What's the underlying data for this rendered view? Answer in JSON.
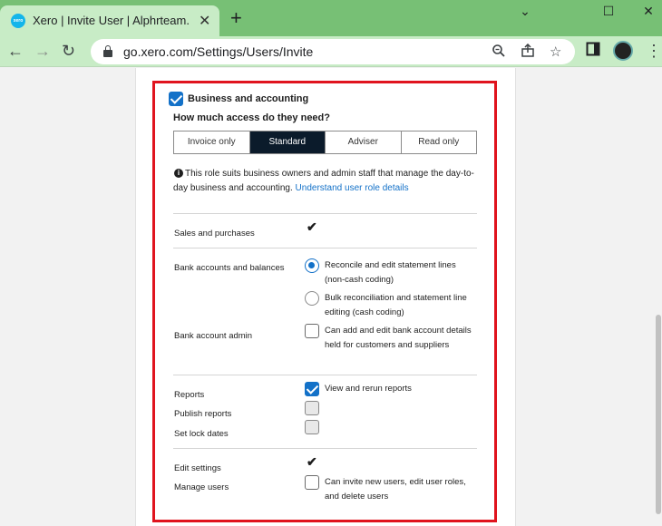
{
  "browser": {
    "tab_title": "Xero | Invite User | Alphrteam.com",
    "favicon_text": "xero",
    "new_tab_label": "+",
    "url": "go.xero.com/Settings/Users/Invite"
  },
  "permissions": {
    "section_label": "Business and accounting",
    "section_checked": true,
    "access_question": "How much access do they need?",
    "access_levels": [
      "Invoice only",
      "Standard",
      "Adviser",
      "Read only"
    ],
    "selected_level": "Standard",
    "info_text": "This role suits business owners and admin staff that manage the day-to-day business and accounting.",
    "info_link": "Understand user role details",
    "sales_label": "Sales and purchases",
    "bank_label": "Bank accounts and balances",
    "bank_option_1": "Reconcile and edit statement lines (non-cash coding)",
    "bank_option_2": "Bulk reconciliation and statement line editing (cash coding)",
    "bank_admin_label": "Bank account admin",
    "bank_admin_option": "Can add and edit bank account details held for customers and suppliers",
    "reports_label": "Reports",
    "reports_option": "View and rerun reports",
    "publish_reports_label": "Publish reports",
    "lock_dates_label": "Set lock dates",
    "edit_settings_label": "Edit settings",
    "manage_users_label": "Manage users",
    "manage_users_option": "Can invite new users, edit user roles, and delete users"
  },
  "colors": {
    "accent": "#1371c8",
    "highlight_border": "#e0141e",
    "chrome_green": "#77c075"
  }
}
